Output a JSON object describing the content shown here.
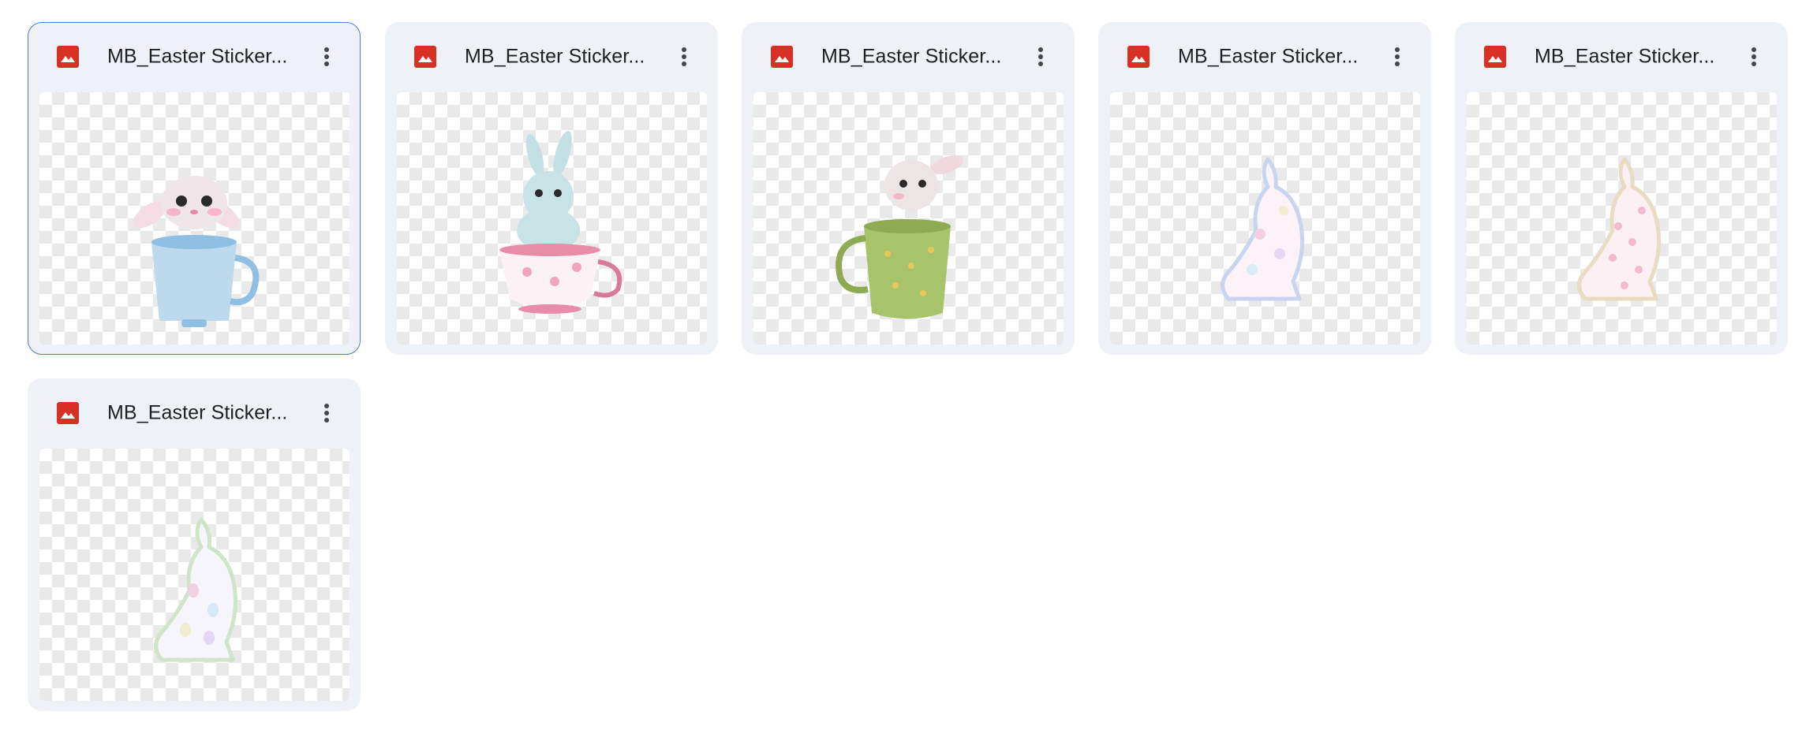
{
  "files": [
    {
      "name": "MB_Easter Sticker...",
      "type_icon": "image-file-icon",
      "thumbnail": "bunny in blue teacup",
      "selected": true
    },
    {
      "name": "MB_Easter Sticker...",
      "type_icon": "image-file-icon",
      "thumbnail": "blue bunny in floral pink teacup",
      "selected": false
    },
    {
      "name": "MB_Easter Sticker...",
      "type_icon": "image-file-icon",
      "thumbnail": "bunny in green polka-dot cup",
      "selected": false
    },
    {
      "name": "MB_Easter Sticker...",
      "type_icon": "image-file-icon",
      "thumbnail": "pastel floral bunny silhouette",
      "selected": false
    },
    {
      "name": "MB_Easter Sticker...",
      "type_icon": "image-file-icon",
      "thumbnail": "pastel leopard bunny silhouette",
      "selected": false
    },
    {
      "name": "MB_Easter Sticker...",
      "type_icon": "image-file-icon",
      "thumbnail": "pastel easter egg bunny silhouette",
      "selected": false
    }
  ],
  "colors": {
    "card_bg": "#eef1f6",
    "selected_border": "#4b7bd8",
    "image_icon": "#d93025",
    "title_text": "#1f1f1f"
  }
}
